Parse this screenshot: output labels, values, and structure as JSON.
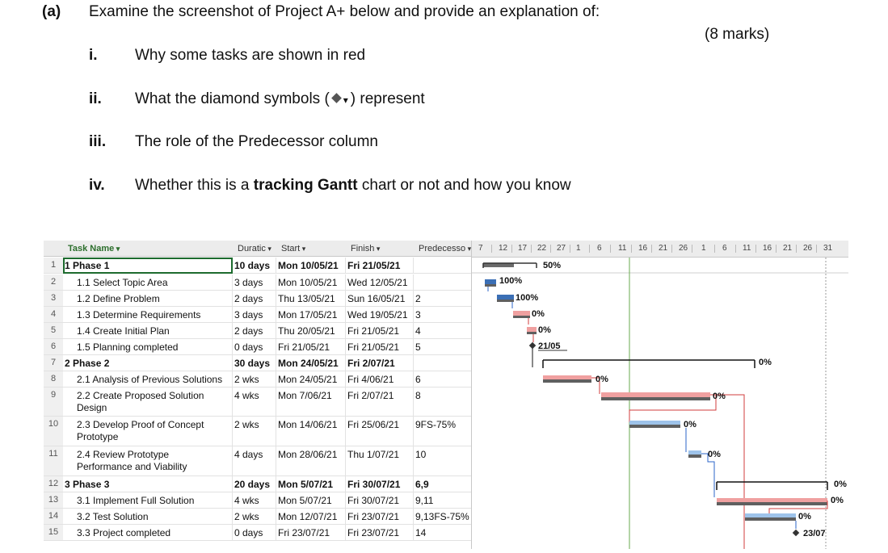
{
  "question": {
    "label": "(a)",
    "stem": "Examine the screenshot of Project A+ below and provide an explanation of:",
    "marks": "(8 marks)",
    "items": [
      {
        "num": "i.",
        "text": "Why some tasks are shown in red"
      },
      {
        "num": "ii.",
        "text_before": "What the diamond symbols (",
        "text_after": ") represent"
      },
      {
        "num": "iii.",
        "text": "The role of the Predecessor column"
      },
      {
        "num": "iv.",
        "text_before": "Whether this is a ",
        "text_bold": "tracking Gantt",
        "text_after": " chart or not and how you know"
      }
    ]
  },
  "screenshot": {
    "columns": [
      "Task Name",
      "Duratic",
      "Start",
      "Finish",
      "Predecesso"
    ],
    "rows": [
      {
        "id": "1",
        "name": "1 Phase 1",
        "dur": "10 days",
        "start": "Mon 10/05/21",
        "finish": "Fri 21/05/21",
        "pred": "",
        "summary": true
      },
      {
        "id": "2",
        "name": "1.1 Select Topic Area",
        "dur": "3 days",
        "start": "Mon 10/05/21",
        "finish": "Wed 12/05/21",
        "pred": ""
      },
      {
        "id": "3",
        "name": "1.2 Define Problem",
        "dur": "2 days",
        "start": "Thu 13/05/21",
        "finish": "Sun 16/05/21",
        "pred": "2"
      },
      {
        "id": "4",
        "name": "1.3 Determine Requirements",
        "dur": "3 days",
        "start": "Mon 17/05/21",
        "finish": "Wed 19/05/21",
        "pred": "3"
      },
      {
        "id": "5",
        "name": "1.4 Create Initial Plan",
        "dur": "2 days",
        "start": "Thu 20/05/21",
        "finish": "Fri 21/05/21",
        "pred": "4"
      },
      {
        "id": "6",
        "name": "1.5 Planning completed",
        "dur": "0 days",
        "start": "Fri 21/05/21",
        "finish": "Fri 21/05/21",
        "pred": "5"
      },
      {
        "id": "7",
        "name": "2 Phase 2",
        "dur": "30 days",
        "start": "Mon 24/05/21",
        "finish": "Fri 2/07/21",
        "pred": "",
        "summary": true
      },
      {
        "id": "8",
        "name": "2.1 Analysis of Previous Solutions",
        "dur": "2 wks",
        "start": "Mon 24/05/21",
        "finish": "Fri 4/06/21",
        "pred": "6"
      },
      {
        "id": "9",
        "name": "2.2 Create Proposed Solution",
        "name2": "Design",
        "dur": "4 wks",
        "start": "Mon 7/06/21",
        "finish": "Fri 2/07/21",
        "pred": "8"
      },
      {
        "id": "10",
        "name": "2.3 Develop Proof of Concept",
        "name2": "Prototype",
        "dur": "2 wks",
        "start": "Mon 14/06/21",
        "finish": "Fri 25/06/21",
        "pred": "9FS-75%"
      },
      {
        "id": "11",
        "name": "2.4 Review Prototype",
        "name2": "Performance and Viability",
        "dur": "4 days",
        "start": "Mon 28/06/21",
        "finish": "Thu 1/07/21",
        "pred": "10"
      },
      {
        "id": "12",
        "name": "3 Phase 3",
        "dur": "20 days",
        "start": "Mon 5/07/21",
        "finish": "Fri 30/07/21",
        "pred": "6,9",
        "summary": true
      },
      {
        "id": "13",
        "name": "3.1 Implement Full Solution",
        "dur": "4 wks",
        "start": "Mon 5/07/21",
        "finish": "Fri 30/07/21",
        "pred": "9,11"
      },
      {
        "id": "14",
        "name": "3.2 Test Solution",
        "dur": "2 wks",
        "start": "Mon 12/07/21",
        "finish": "Fri 23/07/21",
        "pred": "9,13FS-75%"
      },
      {
        "id": "15",
        "name": "3.3 Project completed",
        "dur": "0 days",
        "start": "Fri 23/07/21",
        "finish": "Fri 23/07/21",
        "pred": "14"
      }
    ],
    "timescale_ticks": [
      "7",
      "12",
      "17",
      "22",
      "27",
      "1",
      "6",
      "11",
      "16",
      "21",
      "26",
      "1",
      "6",
      "11",
      "16",
      "21",
      "26",
      "31"
    ],
    "bar_labels": {
      "r1": "50%",
      "r2": "100%",
      "r3": "100%",
      "r4": "0%",
      "r5": "0%",
      "r6": "21/05",
      "r7": "0%",
      "r8": "0%",
      "r9": "0%",
      "r10": "0%",
      "r11": "0%",
      "r12": "0%",
      "r13": "0%",
      "r14": "0%",
      "r15": "23/07"
    },
    "colors": {
      "baseline": "#5f5f5f",
      "critical": "#f0a0a0",
      "complete": "#3b6fb5",
      "noncritical": "#9ec3ea",
      "link_red": "#d23c3c",
      "link_blue": "#2b64c8",
      "status_line": "#6aa84f"
    }
  }
}
